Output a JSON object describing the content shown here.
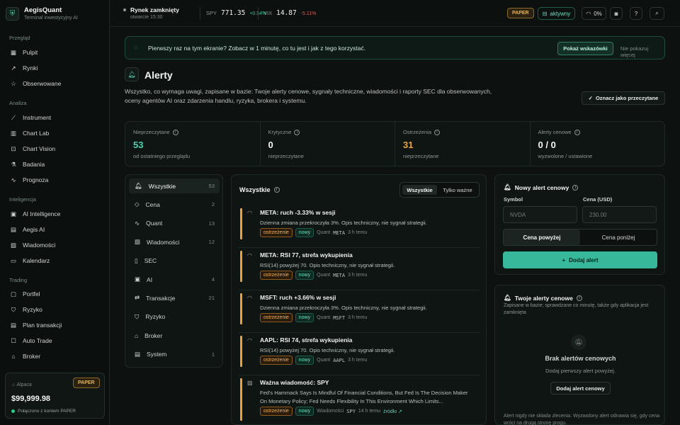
{
  "brand": {
    "name": "AegisQuant",
    "subtitle": "Terminal inwestycyjny AI"
  },
  "nav": {
    "sections": [
      {
        "title": "Przegląd",
        "items": [
          {
            "label": "Pulpit",
            "icon": "grid-icon"
          },
          {
            "label": "Rynki",
            "icon": "trend-icon"
          },
          {
            "label": "Obserwowane",
            "icon": "star-icon"
          }
        ]
      },
      {
        "title": "Analiza",
        "items": [
          {
            "label": "Instrument",
            "icon": "line-chart-icon"
          },
          {
            "label": "Chart Lab",
            "icon": "bar-chart-icon"
          },
          {
            "label": "Chart Vision",
            "icon": "scan-icon"
          },
          {
            "label": "Badania",
            "icon": "flask-icon"
          },
          {
            "label": "Prognoza",
            "icon": "pulse-icon"
          }
        ]
      },
      {
        "title": "Inteligencja",
        "items": [
          {
            "label": "AI Intelligence",
            "icon": "chip-icon"
          },
          {
            "label": "Aegis AI",
            "icon": "chat-icon"
          },
          {
            "label": "Wiadomości",
            "icon": "news-icon"
          },
          {
            "label": "Kalendarz",
            "icon": "calendar-icon"
          }
        ]
      },
      {
        "title": "Trading",
        "items": [
          {
            "label": "Portfel",
            "icon": "wallet-icon"
          },
          {
            "label": "Ryzyko",
            "icon": "shield-icon"
          },
          {
            "label": "Plan transakcji",
            "icon": "plan-icon"
          },
          {
            "label": "Auto Trade",
            "icon": "robot-icon"
          },
          {
            "label": "Broker",
            "icon": "bank-icon"
          }
        ]
      }
    ]
  },
  "account": {
    "broker": "Alpaca",
    "mode": "PAPER",
    "equity": "$99,999.98",
    "status": "Połączono z kontem PAPER"
  },
  "topbar": {
    "market_status": "Rynek zamknięty",
    "market_sub": "otwarcie 15:30",
    "spy": {
      "symbol": "SPY",
      "price": "771.35",
      "change": "+0.54%"
    },
    "vix": {
      "symbol": "VIX",
      "price": "14.87",
      "change": "-5.11%"
    },
    "paper": "PAPER",
    "active": "aktywny",
    "pct": "0%"
  },
  "banner": {
    "text": "Pierwszy raz na tym ekranie? Zobacz w 1 minutę, co tu jest i jak z tego korzystać.",
    "show_tips": "Pokaż wskazówki",
    "dismiss": "Nie pokazuj więcej"
  },
  "page": {
    "title": "Alerty",
    "description": "Wszystko, co wymaga uwagi, zapisane w bazie: Twoje alerty cenowe, sygnały techniczne, wiadomości i raporty SEC dla obserwowanych, oceny agentów AI oraz zdarzenia handlu, ryzyka, brokera i systemu.",
    "mark_read": "Oznacz jako przeczytane"
  },
  "stats": [
    {
      "label": "Nieprzeczytane",
      "value": "53",
      "sub": "od ostatniego przeglądu",
      "color": "#4fd1b0"
    },
    {
      "label": "Krytyczne",
      "value": "0",
      "sub": "nieprzeczytane",
      "color": "#f3f6f4"
    },
    {
      "label": "Ostrzeżenia",
      "value": "31",
      "sub": "nieprzeczytane",
      "color": "#e7a33b"
    },
    {
      "label": "Alerty cenowe",
      "value": "0 / 0",
      "sub": "wyzwolone / ustawione",
      "color": "#f3f6f4"
    }
  ],
  "categories": [
    {
      "label": "Wszystkie",
      "count": "53",
      "icon": "bell-icon"
    },
    {
      "label": "Cena",
      "count": "2",
      "icon": "tag-icon"
    },
    {
      "label": "Quant",
      "count": "13",
      "icon": "pulse-icon"
    },
    {
      "label": "Wiadomości",
      "count": "12",
      "icon": "news-icon"
    },
    {
      "label": "SEC",
      "count": "",
      "icon": "doc-icon"
    },
    {
      "label": "AI",
      "count": "4",
      "icon": "chip-icon"
    },
    {
      "label": "Transakcje",
      "count": "21",
      "icon": "swap-icon"
    },
    {
      "label": "Ryzyko",
      "count": "",
      "icon": "shield-icon"
    },
    {
      "label": "Broker",
      "count": "",
      "icon": "bank-icon"
    },
    {
      "label": "System",
      "count": "1",
      "icon": "server-icon"
    }
  ],
  "list": {
    "title": "Wszystkie",
    "seg_all": "Wszystkie",
    "seg_important": "Tylko ważne",
    "items": [
      {
        "title": "META: ruch -3.33% w sesji",
        "desc": "Dzienna zmiana przekroczyła 3%. Opis techniczny, nie sygnał strategii.",
        "level": "ostrzeżenie",
        "new": "nowy",
        "source": "Quant",
        "symbol": "META",
        "time": "3 h temu",
        "link": ""
      },
      {
        "title": "META: RSI 77, strefa wykupienia",
        "desc": "RSI(14) powyżej 70. Opis techniczny, nie sygnał strategii.",
        "level": "ostrzeżenie",
        "new": "nowy",
        "source": "Quant",
        "symbol": "META",
        "time": "3 h temu",
        "link": ""
      },
      {
        "title": "MSFT: ruch +3.66% w sesji",
        "desc": "Dzienna zmiana przekroczyła 3%. Opis techniczny, nie sygnał strategii.",
        "level": "ostrzeżenie",
        "new": "nowy",
        "source": "Quant",
        "symbol": "MSFT",
        "time": "3 h temu",
        "link": ""
      },
      {
        "title": "AAPL: RSI 74, strefa wykupienia",
        "desc": "RSI(14) powyżej 70. Opis techniczny, nie sygnał strategii.",
        "level": "ostrzeżenie",
        "new": "nowy",
        "source": "Quant",
        "symbol": "AAPL",
        "time": "3 h temu",
        "link": ""
      },
      {
        "title": "Ważna wiadomość: SPY",
        "desc": "Fed's Hammack Says Is Mindful Of Financial Conditions, But Fed Is The Decision Maker On Monetary Policy; Fed Needs Flexibility In This Environment Which Limits...",
        "level": "ostrzeżenie",
        "new": "nowy",
        "source": "Wiadomości",
        "symbol": "SPY",
        "time": "14 h temu",
        "link": "źródło ↗"
      }
    ]
  },
  "new_alert": {
    "title": "Nowy alert cenowy",
    "symbol_label": "Symbol",
    "symbol_placeholder": "NVDA",
    "price_label": "Cena (USD)",
    "price_placeholder": "230.00",
    "above": "Cena powyżej",
    "below": "Cena poniżej",
    "add": "Dodaj alert"
  },
  "my_alerts": {
    "title": "Twoje alerty cenowe",
    "sub": "Zapisane w bazie; sprawdzane co minutę, także gdy aplikacja jest zamknięta",
    "empty_title": "Brak alertów cenowych",
    "empty_sub": "Dodaj pierwszy alert powyżej.",
    "empty_btn": "Dodaj alert cenowy",
    "footer": "Alert nigdy nie składa zlecenia. Wyzwolony alert odnawia się, gdy cena wróci na drugą stronę progu."
  },
  "colors": {
    "accent": "#4fd1b0",
    "warning": "#e7a33b",
    "positive": "#2fc98e",
    "negative": "#e05a5a"
  }
}
